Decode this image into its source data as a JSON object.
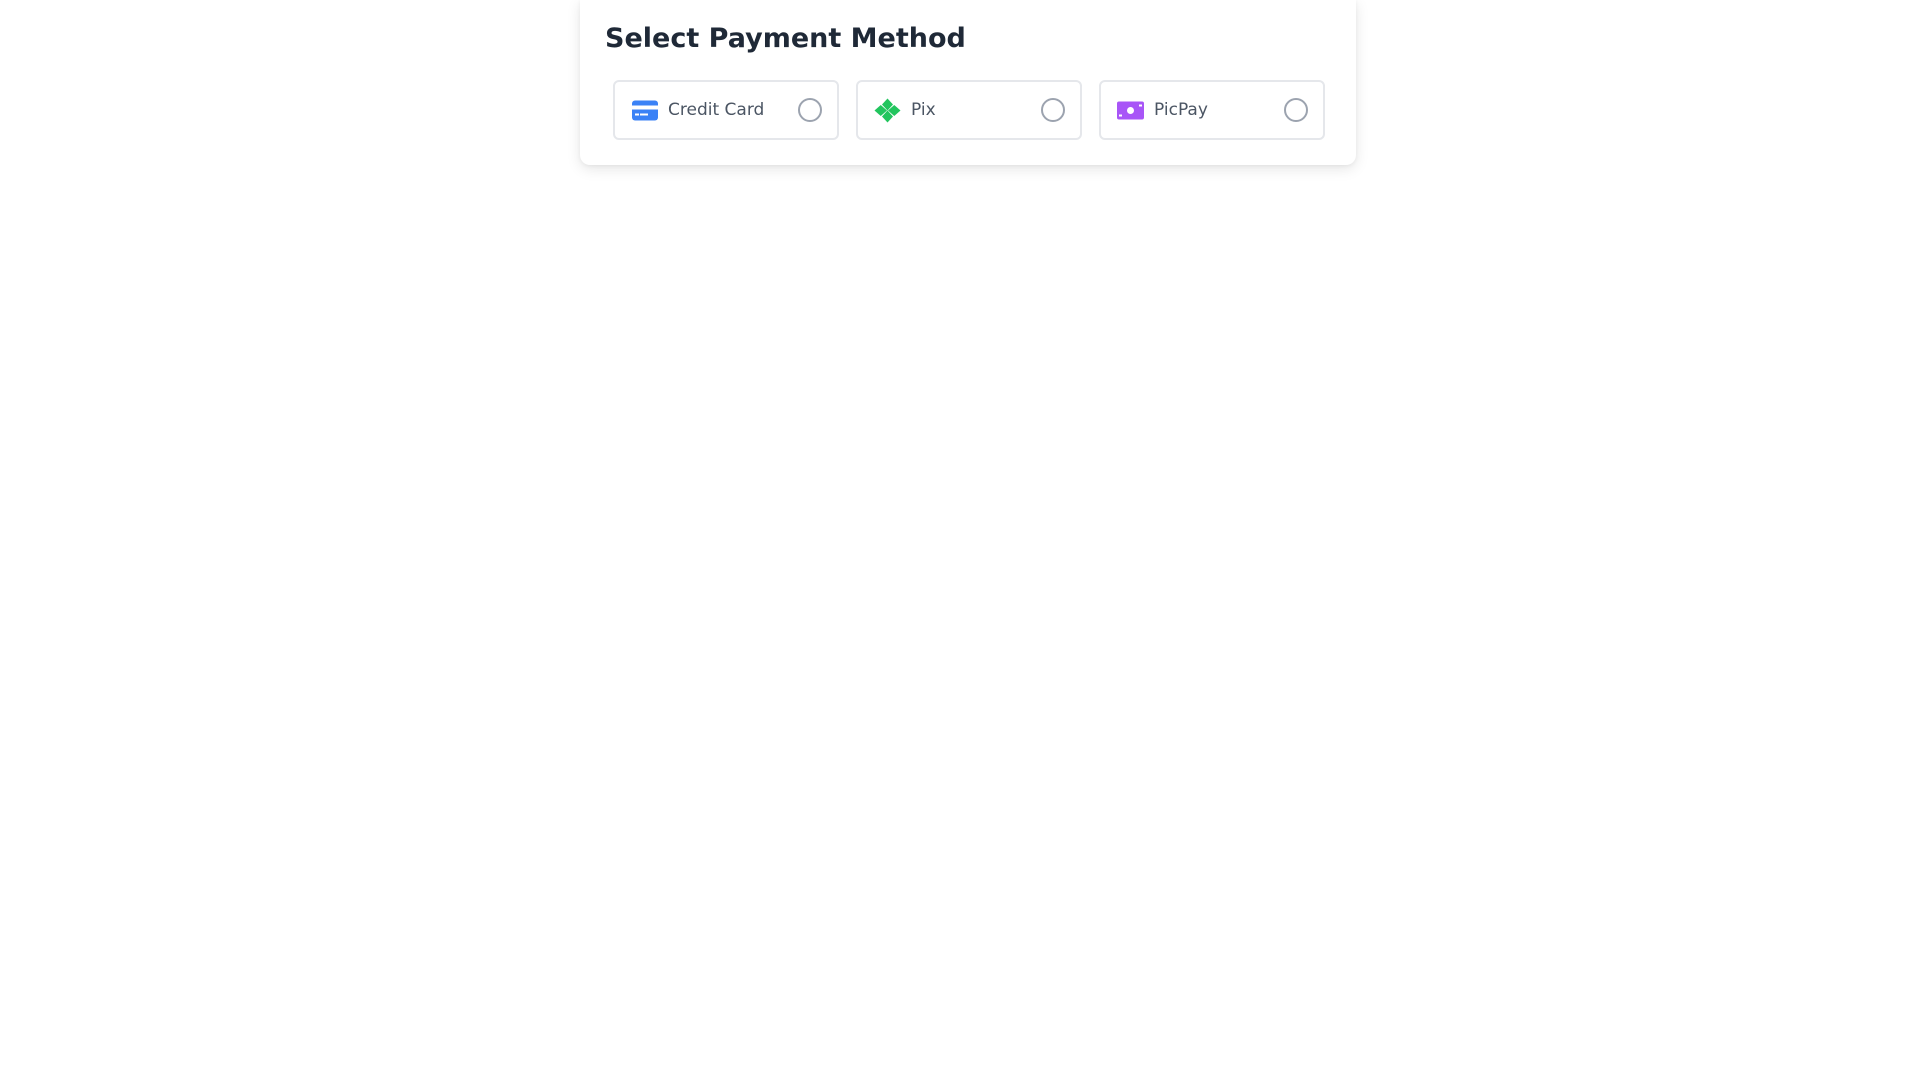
{
  "header": {
    "title": "Select Payment Method"
  },
  "payment_options": [
    {
      "label": "Credit Card",
      "icon": "credit-card-icon",
      "icon_color": "#3b82f6",
      "selected": false
    },
    {
      "label": "Pix",
      "icon": "pix-icon",
      "icon_color": "#22c55e",
      "selected": false
    },
    {
      "label": "PicPay",
      "icon": "money-bill-icon",
      "icon_color": "#a855f7",
      "selected": false
    }
  ],
  "colors": {
    "title": "#1f2937",
    "option_border": "#e5e7eb",
    "radio_border": "#9ca3af",
    "label": "#4b5563"
  }
}
